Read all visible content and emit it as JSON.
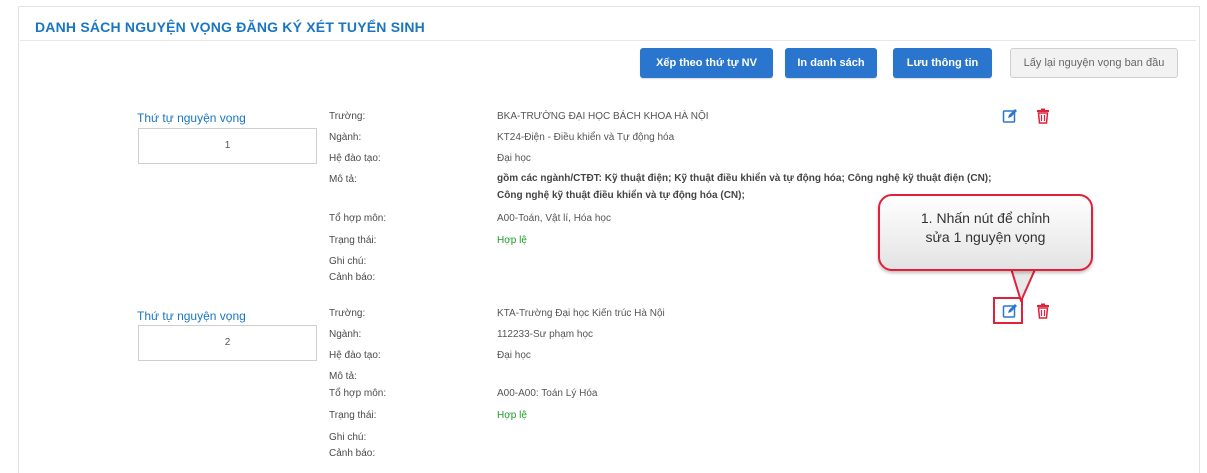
{
  "page": {
    "title": "DANH SÁCH NGUYỆN VỌNG ĐĂNG KÝ XÉT TUYỂN SINH"
  },
  "toolbar": {
    "sort_label": "Xếp theo thứ tự NV",
    "print_label": "In danh sách",
    "save_label": "Lưu thông tin",
    "reset_label": "Lấy lại nguyện vọng ban đầu"
  },
  "labels": {
    "order": "Thứ tự nguyện vọng",
    "school": "Trường:",
    "major": "Ngành:",
    "training": "Hệ đào tạo:",
    "description": "Mô tả:",
    "subjects": "Tổ hợp môn:",
    "status": "Trạng thái:",
    "note": "Ghi chú:",
    "warning": "Cảnh báo:"
  },
  "wishes": [
    {
      "order": "1",
      "school": "BKA-TRƯỜNG ĐẠI HỌC BÁCH KHOA HÀ NỘI",
      "major": "KT24-Điện - Điều khiển và Tự động hóa",
      "training": "Đại học",
      "description": "gồm các ngành/CTĐT: Kỹ thuật điện; Kỹ thuật điều khiển và tự động hóa; Công nghệ kỹ thuật điện (CN); Công nghệ kỹ thuật điều khiển và tự động hóa (CN);",
      "subjects": "A00-Toán, Vật lí, Hóa học",
      "status": "Hợp lệ"
    },
    {
      "order": "2",
      "school": "KTA-Trường Đại học Kiến trúc Hà Nội",
      "major": "112233-Sư phạm học",
      "training": "Đại học",
      "description": "",
      "subjects": "A00-A00: Toán Lý Hóa",
      "status": "Hợp lệ"
    }
  ],
  "callout": {
    "line1": "1. Nhấn nút để chỉnh",
    "line2": "sửa 1 nguyện vọng"
  },
  "colors": {
    "primary": "#2a76cf",
    "title": "#1a76c2",
    "valid": "#1d9b2a",
    "delete": "#e0213a"
  }
}
